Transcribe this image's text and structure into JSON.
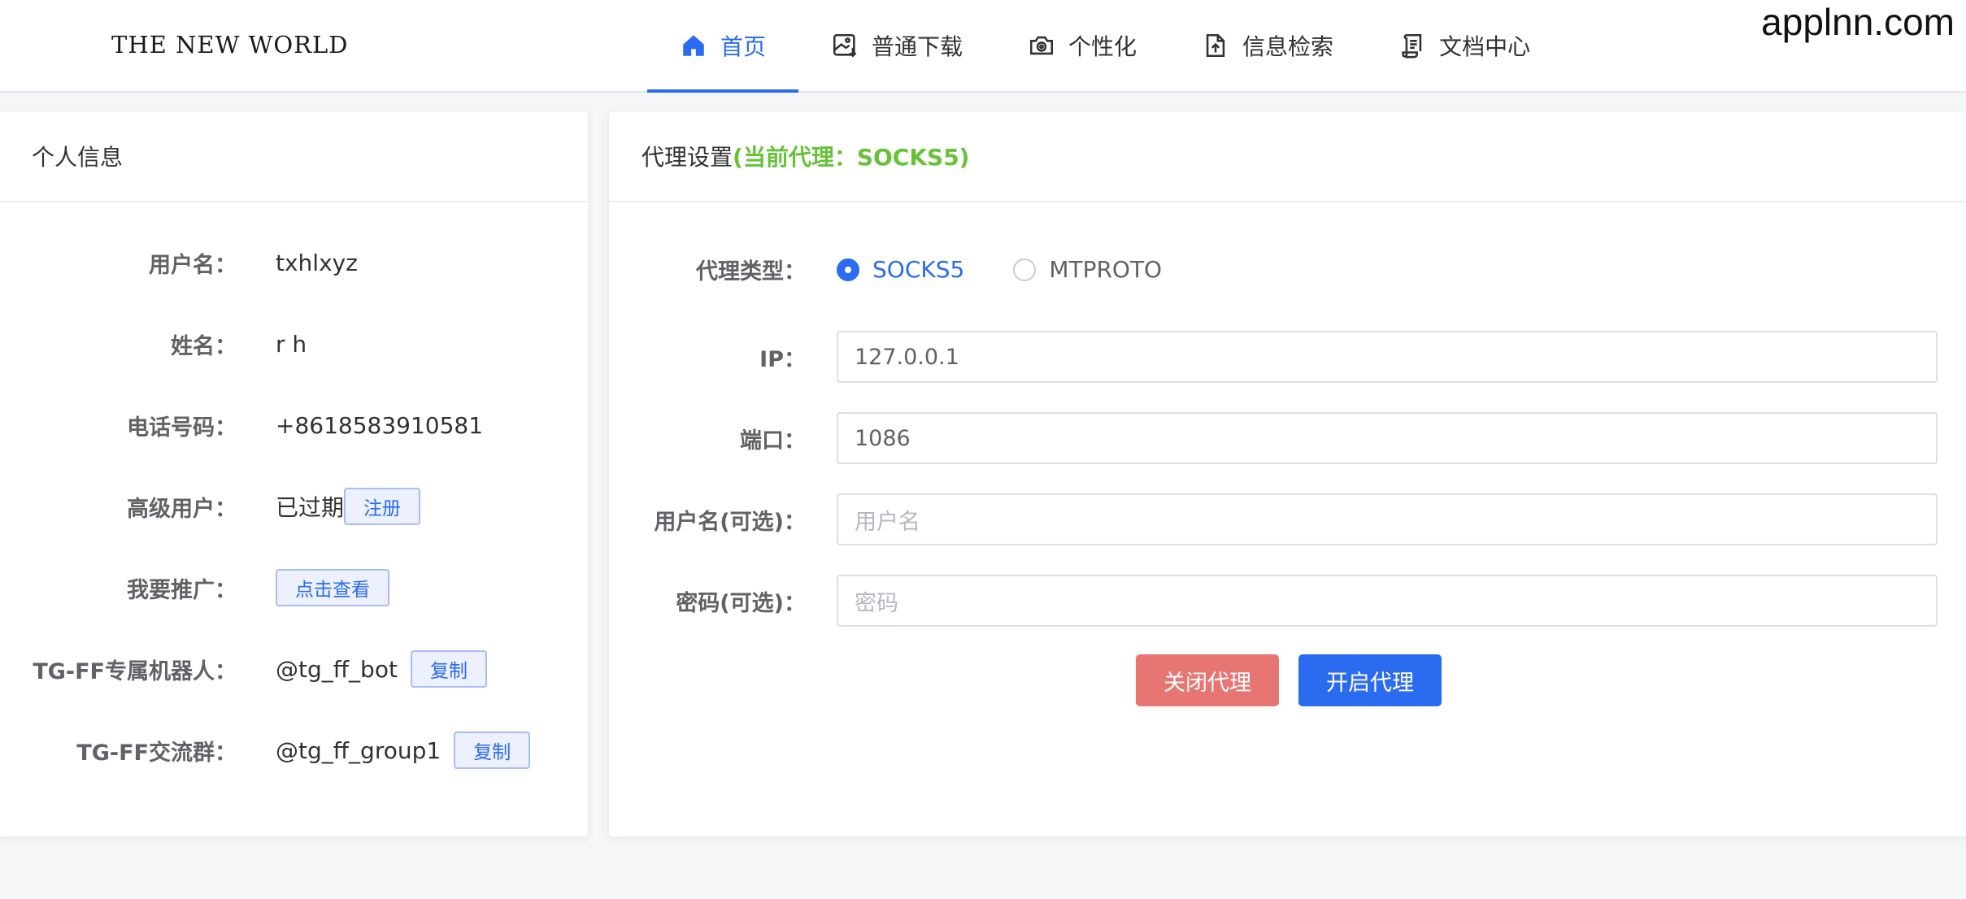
{
  "brand": {
    "logo": "THE NEW WORLD",
    "watermark": "applnn.com"
  },
  "nav": [
    {
      "label": "首页",
      "icon": "home-icon",
      "active": true
    },
    {
      "label": "普通下载",
      "icon": "image-download-icon"
    },
    {
      "label": "个性化",
      "icon": "camera-gear-icon"
    },
    {
      "label": "信息检索",
      "icon": "document-icon"
    },
    {
      "label": "文档中心",
      "icon": "scroll-document-icon"
    }
  ],
  "profile": {
    "title": "个人信息",
    "rows": {
      "username": {
        "label": "用户名：",
        "value": "txhlxyz"
      },
      "name": {
        "label": "姓名：",
        "value": "r h"
      },
      "phone": {
        "label": "电话号码：",
        "value": "+8618583910581"
      },
      "premium": {
        "label": "高级用户：",
        "value": "已过期",
        "button": "注册"
      },
      "promote": {
        "label": "我要推广：",
        "button": "点击查看"
      },
      "bot": {
        "label": "TG-FF专属机器人：",
        "value": "@tg_ff_bot",
        "button": "复制"
      },
      "group": {
        "label": "TG-FF交流群：",
        "value": "@tg_ff_group1",
        "button": "复制"
      }
    }
  },
  "proxy": {
    "title": "代理设置",
    "current": "(当前代理：SOCKS5)",
    "type_label": "代理类型：",
    "options": [
      {
        "label": "SOCKS5",
        "checked": true
      },
      {
        "label": "MTPROTO",
        "checked": false
      }
    ],
    "ip": {
      "label": "IP：",
      "value": "127.0.0.1"
    },
    "port": {
      "label": "端口：",
      "value": "1086"
    },
    "user": {
      "label": "用户名(可选)：",
      "placeholder": "用户名"
    },
    "password": {
      "label": "密码(可选)：",
      "placeholder": "密码"
    },
    "close_button": "关闭代理",
    "open_button": "开启代理"
  },
  "colors": {
    "primary": "#2a6bf0",
    "success": "#67c23a",
    "danger": "#e77672"
  }
}
